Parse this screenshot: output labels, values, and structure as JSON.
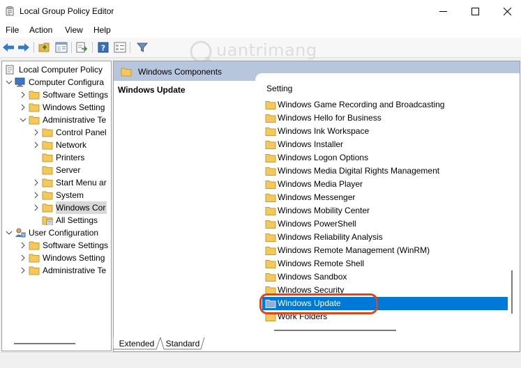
{
  "window": {
    "title": "Local Group Policy Editor",
    "minimize_glyph": "—",
    "maximize_glyph": "☐",
    "close_glyph": "✕"
  },
  "menu": [
    "File",
    "Action",
    "View",
    "Help"
  ],
  "watermark": {
    "text": "uantrimang"
  },
  "tree": [
    {
      "label": "Local Computer Policy"
    },
    {
      "label": "Computer Configura"
    },
    {
      "label": "Software Settings"
    },
    {
      "label": "Windows Setting"
    },
    {
      "label": "Administrative Te"
    },
    {
      "label": "Control Panel"
    },
    {
      "label": "Network"
    },
    {
      "label": "Printers"
    },
    {
      "label": "Server"
    },
    {
      "label": "Start Menu ar"
    },
    {
      "label": "System"
    },
    {
      "label": "Windows Cor"
    },
    {
      "label": "All Settings"
    },
    {
      "label": "User Configuration"
    },
    {
      "label": "Software Settings"
    },
    {
      "label": "Windows Setting"
    },
    {
      "label": "Administrative Te"
    }
  ],
  "header": {
    "folder": "Windows Components"
  },
  "description": {
    "title": "Windows Update"
  },
  "list": {
    "column": "Setting",
    "items": [
      "Windows Game Recording and Broadcasting",
      "Windows Hello for Business",
      "Windows Ink Workspace",
      "Windows Installer",
      "Windows Logon Options",
      "Windows Media Digital Rights Management",
      "Windows Media Player",
      "Windows Messenger",
      "Windows Mobility Center",
      "Windows PowerShell",
      "Windows Reliability Analysis",
      "Windows Remote Management (WinRM)",
      "Windows Remote Shell",
      "Windows Sandbox",
      "Windows Security",
      "Windows Update",
      "Work Folders"
    ],
    "selected": "Windows Update"
  },
  "tabs": [
    "Extended",
    "Standard"
  ],
  "colors": {
    "selection": "#0078d7",
    "highlight_ring": "#e0441b",
    "header_band": "#b7c6dc"
  }
}
